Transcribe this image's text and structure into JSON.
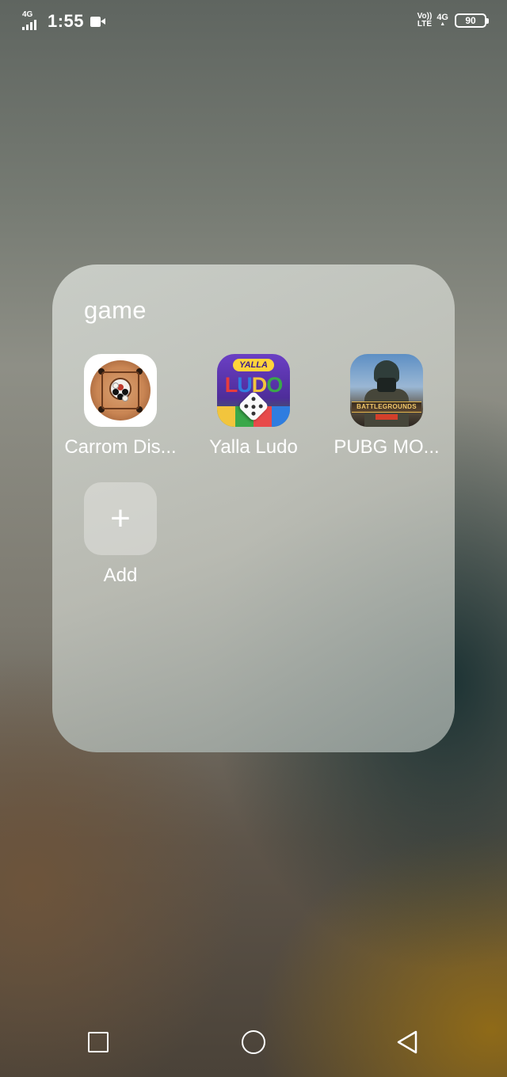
{
  "status_bar": {
    "network_type": "4G",
    "time": "1:55",
    "volte_top": "Vo))",
    "volte_bottom": "LTE",
    "data_type": "4G",
    "data_arrow": "▲",
    "battery_level": "90",
    "icons": [
      "signal-icon",
      "video-record-icon",
      "volte-icon",
      "battery-icon"
    ]
  },
  "folder": {
    "title": "game",
    "apps": [
      {
        "label": "Carrom Dis...",
        "icon": "carrom-disc-icon"
      },
      {
        "label": "Yalla Ludo",
        "icon": "yalla-ludo-icon"
      },
      {
        "label": "PUBG MO...",
        "icon": "pubg-mobile-icon"
      }
    ],
    "add": {
      "label": "Add",
      "symbol": "+",
      "icon": "plus-icon"
    },
    "ludo_logo": {
      "top": "YALLA",
      "word": [
        "L",
        "U",
        "D",
        "O"
      ],
      "word_colors": [
        "#e83c3c",
        "#2f7de0",
        "#f2c53d",
        "#3aa84a"
      ]
    },
    "pubg_logo": "BATTLEGROUNDS"
  },
  "nav_bar": {
    "buttons": [
      "recents-button",
      "home-button",
      "back-button"
    ]
  },
  "colors": {
    "text": "#ffffff",
    "folder_bg": "#c6c8c0"
  }
}
